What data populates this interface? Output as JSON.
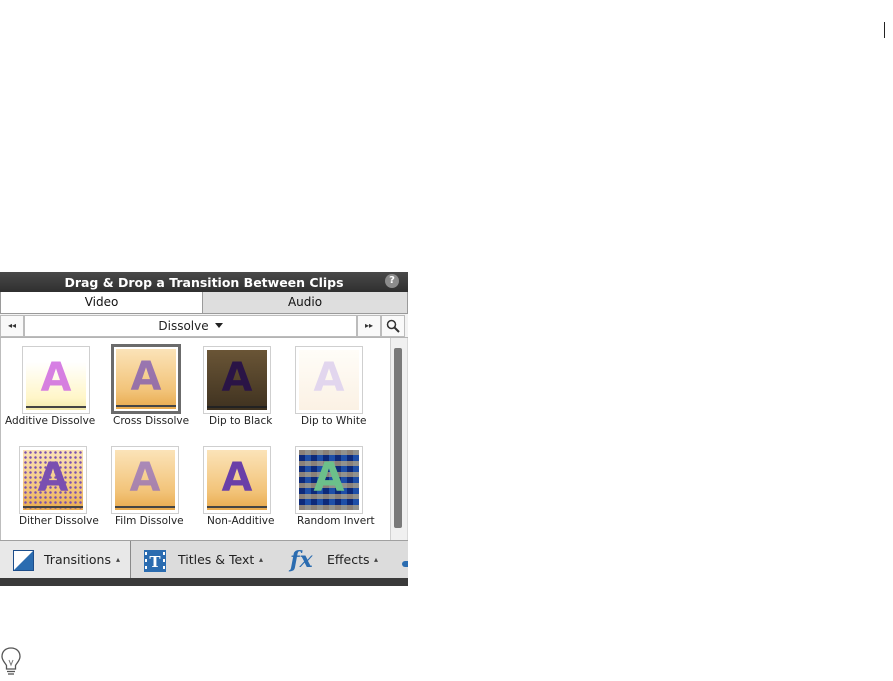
{
  "panel": {
    "title": "Drag & Drop a Transition Between Clips",
    "help_glyph": "?",
    "tabs": [
      {
        "label": "Video",
        "active": true
      },
      {
        "label": "Audio",
        "active": false
      }
    ],
    "category_dropdown": "Dissolve",
    "nav_prev_glyph": "◂◂",
    "nav_next_glyph": "▸▸",
    "transitions": [
      {
        "label": "Additive Dissolve"
      },
      {
        "label": "Cross Dissolve",
        "selected": true
      },
      {
        "label": "Dip to Black"
      },
      {
        "label": "Dip to White"
      },
      {
        "label": "Dither Dissolve"
      },
      {
        "label": "Film Dissolve"
      },
      {
        "label": "Non-Additive"
      },
      {
        "label": "Random Invert"
      }
    ],
    "bottom_tabs": [
      {
        "label": "Transitions",
        "icon": "transitions-icon",
        "active": true
      },
      {
        "label": "Titles & Text",
        "icon": "titles-text-icon",
        "active": false
      },
      {
        "label": "Effects",
        "icon": "fx-icon",
        "active": false
      }
    ],
    "thumb_letter": "A",
    "fx_glyph": "fx"
  },
  "colors": {
    "title_bar": "#3a3a3a",
    "accent_blue": "#2b6cb0",
    "letter_purple": "#7a4fb0"
  }
}
